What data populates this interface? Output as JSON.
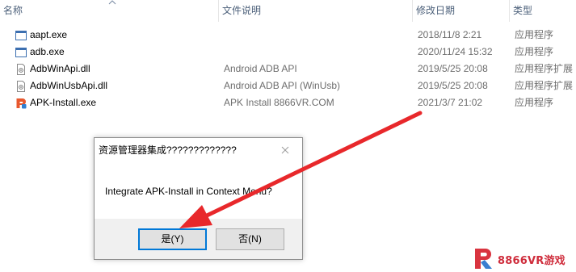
{
  "columns": {
    "name": "名称",
    "description": "文件说明",
    "modified": "修改日期",
    "type": "类型"
  },
  "files": [
    {
      "name": "aapt.exe",
      "description": "",
      "modified": "2018/11/8 2:21",
      "type": "应用程序",
      "icon": "exe-icon"
    },
    {
      "name": "adb.exe",
      "description": "",
      "modified": "2020/11/24 15:32",
      "type": "应用程序",
      "icon": "exe-icon"
    },
    {
      "name": "AdbWinApi.dll",
      "description": "Android ADB API",
      "modified": "2019/5/25 20:08",
      "type": "应用程序扩展",
      "icon": "dll-icon"
    },
    {
      "name": "AdbWinUsbApi.dll",
      "description": "Android ADB API (WinUsb)",
      "modified": "2019/5/25 20:08",
      "type": "应用程序扩展",
      "icon": "dll-icon"
    },
    {
      "name": "APK-Install.exe",
      "description": "APK Install 8866VR.COM",
      "modified": "2021/3/7 21:02",
      "type": "应用程序",
      "icon": "apk-install-icon"
    }
  ],
  "dialog": {
    "title": "资源管理器集成?????????????",
    "message": "Integrate APK-Install in Context Menu?",
    "yes_label": "是(Y)",
    "no_label": "否(N)"
  },
  "watermark": {
    "text": "8866VR游戏",
    "color": "#cf2d3c"
  },
  "colors": {
    "arrow": "#e8282b",
    "default_button_border": "#0078d7"
  }
}
